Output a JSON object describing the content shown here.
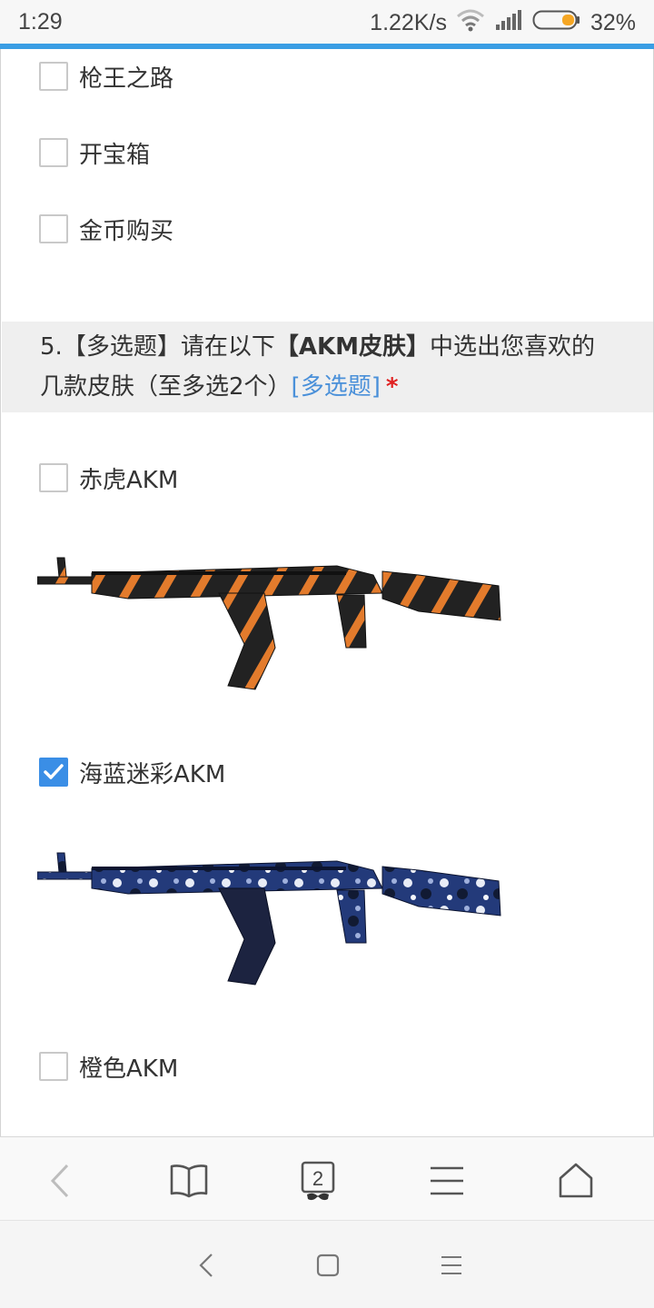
{
  "status_bar": {
    "time": "1:29",
    "network_speed": "1.22K/s",
    "battery_percent": "32%",
    "battery_level": 0.32,
    "icons": [
      "wifi-icon",
      "signal-icon",
      "battery-icon"
    ]
  },
  "colors": {
    "accent": "#3a9ee4",
    "checkbox_checked": "#3a8ee6",
    "tag_blue": "#4a90d9",
    "required_red": "#e02020",
    "question_bg": "#efefef"
  },
  "prev_question_options": [
    {
      "label": "枪王之路",
      "checked": false
    },
    {
      "label": "开宝箱",
      "checked": false
    },
    {
      "label": "金币购买",
      "checked": false
    }
  ],
  "question": {
    "number": "5.",
    "type_bracket": "【多选题】",
    "text_before": "请在以下",
    "highlight": "【AKM皮肤】",
    "text_after": "中选出您喜欢的",
    "line2": "几款皮肤（至多选2个）",
    "tag": "[多选题]",
    "required_mark": "*"
  },
  "options": [
    {
      "label": "赤虎AKM",
      "checked": false,
      "image": "akm-red-tiger-image"
    },
    {
      "label": "海蓝迷彩AKM",
      "checked": true,
      "image": "akm-blue-camo-image"
    },
    {
      "label": "橙色AKM",
      "checked": false
    }
  ],
  "toolbar": {
    "tab_count": "2",
    "icons": [
      "back-arrow-icon",
      "bookmarks-icon",
      "tabs-icon",
      "menu-icon",
      "home-icon"
    ]
  },
  "system_nav": {
    "icons": [
      "nav-back-icon",
      "nav-home-icon",
      "nav-recents-icon"
    ]
  }
}
